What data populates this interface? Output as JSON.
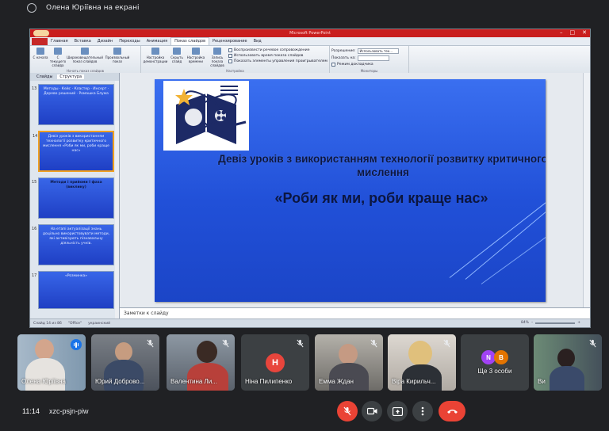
{
  "presenter_label": "Олена Юріївна на екрані",
  "ppt": {
    "window_title": "Microsoft PowerPoint",
    "tabs": [
      "Главная",
      "Вставка",
      "Дизайн",
      "Переходы",
      "Анимация",
      "Показ слайдов",
      "Рецензирование",
      "Вид"
    ],
    "file_tab": "",
    "active_tab": "Показ слайдов",
    "ribbon": {
      "buttons": [
        {
          "label": "С начала"
        },
        {
          "label": "С текущего слайда"
        },
        {
          "label": "Широковещательный показ слайдов"
        },
        {
          "label": "Произвольный показ"
        },
        {
          "label": "Настройка демонстрации"
        },
        {
          "label": "Скрыть слайд"
        },
        {
          "label": "Настройка времени"
        },
        {
          "label": "Запись показа слайдов"
        }
      ],
      "group_start": "Начать показ слайдов",
      "group_setup": "Настройка",
      "group_monitors": "Мониторы",
      "checkboxes": [
        "Воспроизвести речевое сопровождение",
        "Использовать время показа слайдов",
        "Показать элементы управления проигрывателем"
      ],
      "monitor_label": "Разрешение:",
      "monitor_value": "Использовать тек...",
      "show_on_label": "Показать на:",
      "presenter_view": "Режим докладчика"
    },
    "thumb_tabs": [
      "Слайды",
      "Структура"
    ],
    "thumbnails": [
      {
        "num": "13",
        "text": "Методы · Кейс · Кластер · Инсерт · Дерево решений · Ромашка Блума"
      },
      {
        "num": "14",
        "text": "Девіз уроків з використанням технології розвитку критичного мислення «Роби як ми, роби краще нас»"
      },
      {
        "num": "15",
        "text": "Методи і прийоми І фаза (виклику)"
      },
      {
        "num": "16",
        "text": "На етапі актуалізації знань доцільно використовувати методи, які активізують пізнавальну діяльність учнів."
      },
      {
        "num": "17",
        "text": "«Розминка»"
      }
    ],
    "slide": {
      "title1": "Девіз уроків з використанням технології розвитку критичного мислення",
      "title2": "«Роби як ми, роби краще нас»"
    },
    "notes_placeholder": "Заметки к слайду",
    "status": {
      "slide_info": "Слайд 14 из 86",
      "theme": "\"Officе\"",
      "language": "украинский",
      "zoom": "84%"
    }
  },
  "participants": [
    {
      "name": "Олена Юріївна",
      "speaking": true
    },
    {
      "name": "Юрий Доброво...",
      "muted": true
    },
    {
      "name": "Валентина Ли...",
      "muted": true
    },
    {
      "name": "Ніна Пилипенко",
      "muted": true,
      "initial": "Н",
      "color": "#e8453c"
    },
    {
      "name": "Емма Ждан",
      "muted": true
    },
    {
      "name": "Віра Кирильч...",
      "muted": true
    },
    {
      "name": "Ще 3 особи",
      "initials": [
        "N",
        "B"
      ],
      "colors": [
        "#a142f4",
        "#e37400"
      ]
    },
    {
      "name": "Ви",
      "muted": true
    }
  ],
  "bottom": {
    "time": "11:14",
    "meeting_code": "xzc-psjn-piw",
    "colors": {
      "danger": "#ea4335",
      "control": "#3c4043"
    }
  }
}
